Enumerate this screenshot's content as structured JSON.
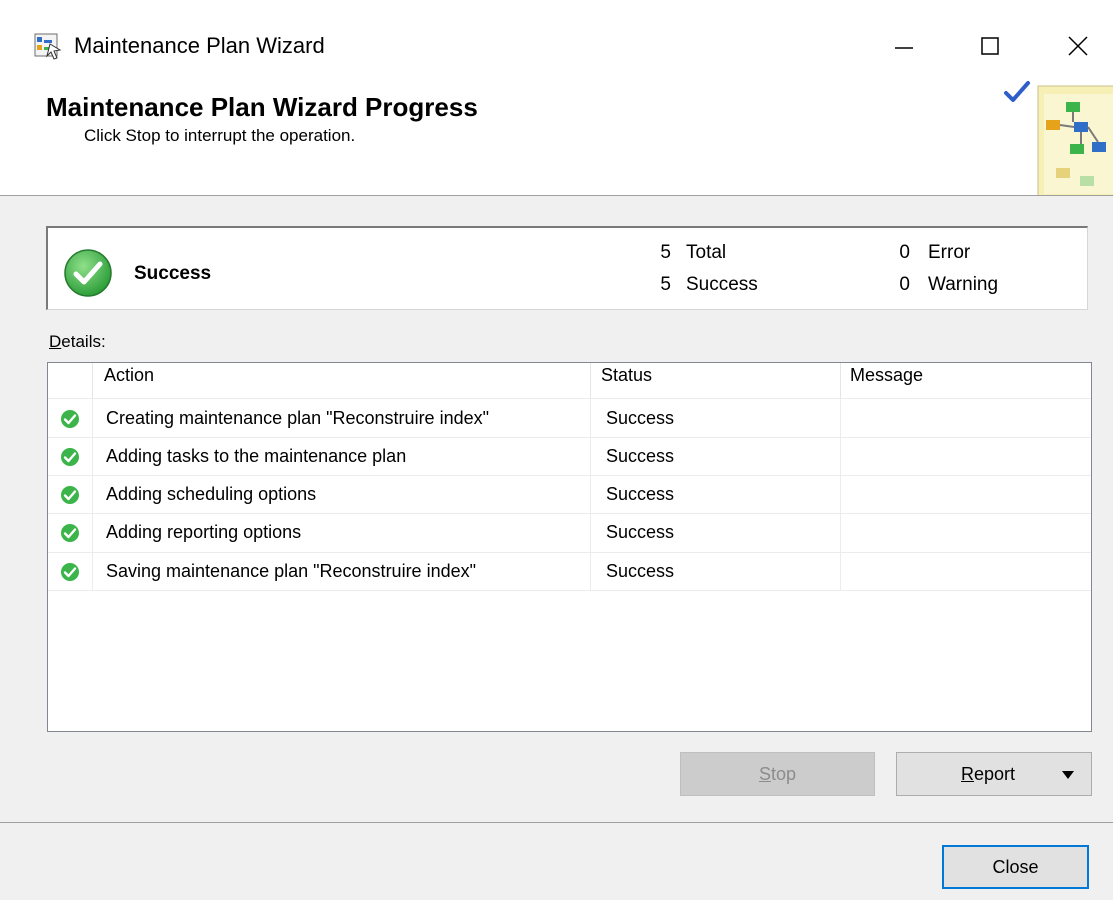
{
  "window": {
    "title": "Maintenance Plan Wizard",
    "icon": "wizard-app-icon"
  },
  "header": {
    "title": "Maintenance Plan Wizard Progress",
    "subtitle": "Click Stop to interrupt the operation."
  },
  "summary": {
    "status": "Success",
    "total_count": "5",
    "total_label": "Total",
    "success_count": "5",
    "success_label": "Success",
    "error_count": "0",
    "error_label": "Error",
    "warning_count": "0",
    "warning_label": "Warning"
  },
  "details": {
    "label_mnemonic": "D",
    "label_rest": "etails:",
    "columns": [
      "Action",
      "Status",
      "Message"
    ],
    "rows": [
      {
        "action": "Creating maintenance plan \"Reconstruire index\"",
        "status": "Success",
        "message": ""
      },
      {
        "action": "Adding tasks to the maintenance plan",
        "status": "Success",
        "message": ""
      },
      {
        "action": "Adding scheduling options",
        "status": "Success",
        "message": ""
      },
      {
        "action": "Adding reporting options",
        "status": "Success",
        "message": ""
      },
      {
        "action": "Saving maintenance plan \"Reconstruire index\"",
        "status": "Success",
        "message": ""
      }
    ]
  },
  "buttons": {
    "stop_mnemonic": "S",
    "stop_rest": "top",
    "report_mnemonic": "R",
    "report_rest": "eport",
    "close": "Close"
  },
  "colors": {
    "success_green": "#3bb54a",
    "accent_blue": "#0078d7",
    "disabled_gray": "#cccccc"
  }
}
